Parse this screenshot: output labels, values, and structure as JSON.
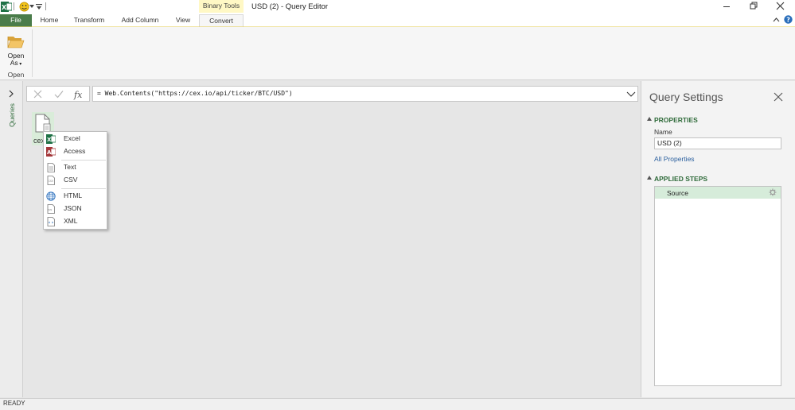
{
  "window": {
    "title": "USD (2) - Query Editor",
    "contextual_tab": "Binary Tools"
  },
  "ribbon": {
    "tabs": [
      "File",
      "Home",
      "Transform",
      "Add Column",
      "View",
      "Convert"
    ],
    "open_as_line1": "Open",
    "open_as_line2": "As",
    "group_label": "Open"
  },
  "formula_bar": {
    "value": "= Web.Contents(\"https://cex.io/api/ticker/BTC/USD\")"
  },
  "queries_pane": {
    "label": "Queries"
  },
  "content": {
    "file_label": "cex"
  },
  "context_menu": {
    "items": [
      "Excel",
      "Access",
      "Text",
      "CSV",
      "HTML",
      "JSON",
      "XML"
    ]
  },
  "settings": {
    "title": "Query Settings",
    "properties_header": "PROPERTIES",
    "name_label": "Name",
    "name_value": "USD (2)",
    "all_properties": "All Properties",
    "applied_steps_header": "APPLIED STEPS",
    "steps": [
      "Source"
    ]
  },
  "status": {
    "text": "READY"
  },
  "colors": {
    "accent": "#217346",
    "selected_step": "#d6ecda",
    "context_tab": "#fff8c5"
  }
}
